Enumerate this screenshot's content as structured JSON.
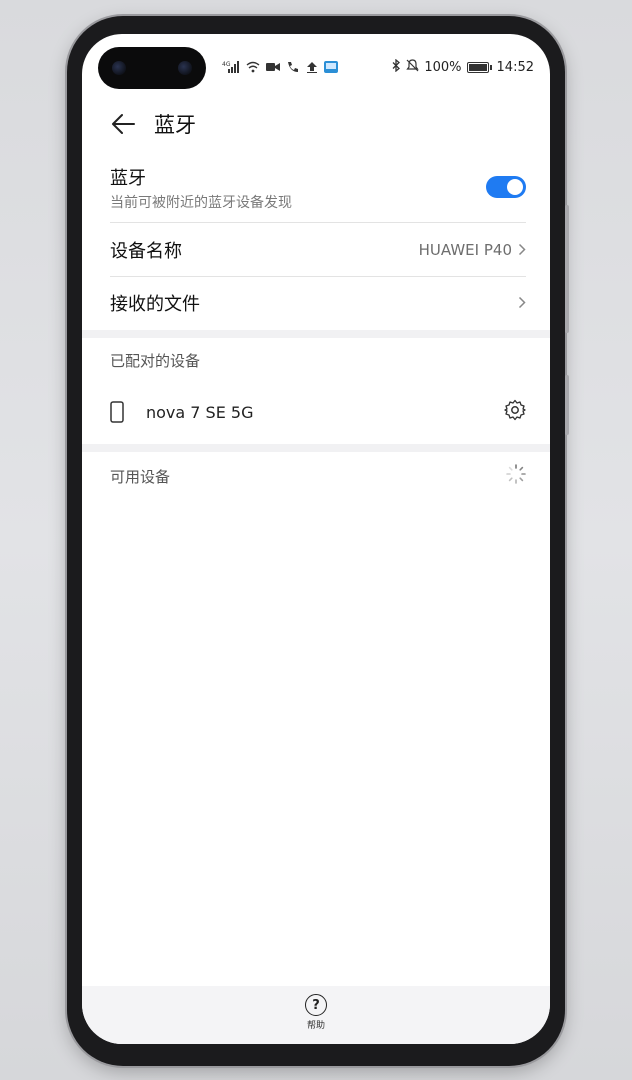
{
  "status_bar": {
    "battery": "100%",
    "time": "14:52",
    "battery_level": 1.0
  },
  "header": {
    "title": "蓝牙"
  },
  "bluetooth": {
    "title": "蓝牙",
    "subtitle": "当前可被附近的蓝牙设备发现",
    "enabled": true,
    "accent_color": "#1f7bf2"
  },
  "settings": {
    "device_name_label": "设备名称",
    "device_name_value": "HUAWEI P40",
    "received_files_label": "接收的文件"
  },
  "paired": {
    "section_label": "已配对的设备",
    "devices": [
      {
        "name": "nova 7 SE 5G",
        "icon": "phone-icon"
      }
    ]
  },
  "available": {
    "section_label": "可用设备"
  },
  "bottom": {
    "help_label": "帮助"
  }
}
